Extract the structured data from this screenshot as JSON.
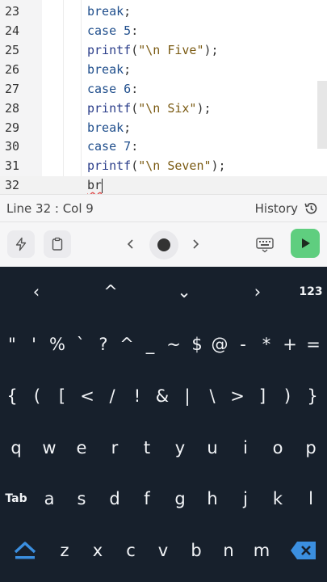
{
  "editor": {
    "lines": [
      {
        "num": "23",
        "tokens": [
          {
            "t": "break",
            "c": "kw"
          },
          {
            "t": ";",
            "c": "pl"
          }
        ]
      },
      {
        "num": "24",
        "tokens": [
          {
            "t": "case ",
            "c": "kw"
          },
          {
            "t": "5",
            "c": "kw"
          },
          {
            "t": ":",
            "c": "pl"
          }
        ]
      },
      {
        "num": "25",
        "tokens": [
          {
            "t": "printf",
            "c": "fn"
          },
          {
            "t": "(",
            "c": "pl"
          },
          {
            "t": "\"\\n Five\"",
            "c": "str"
          },
          {
            "t": ");",
            "c": "pl"
          }
        ]
      },
      {
        "num": "26",
        "tokens": [
          {
            "t": "break",
            "c": "kw"
          },
          {
            "t": ";",
            "c": "pl"
          }
        ]
      },
      {
        "num": "27",
        "tokens": [
          {
            "t": "case ",
            "c": "kw"
          },
          {
            "t": "6",
            "c": "kw"
          },
          {
            "t": ":",
            "c": "pl"
          }
        ]
      },
      {
        "num": "28",
        "tokens": [
          {
            "t": "printf",
            "c": "fn"
          },
          {
            "t": "(",
            "c": "pl"
          },
          {
            "t": "\"\\n Six\"",
            "c": "str"
          },
          {
            "t": ");",
            "c": "pl"
          }
        ]
      },
      {
        "num": "29",
        "tokens": [
          {
            "t": "break",
            "c": "kw"
          },
          {
            "t": ";",
            "c": "pl"
          }
        ]
      },
      {
        "num": "30",
        "tokens": [
          {
            "t": "case ",
            "c": "kw"
          },
          {
            "t": "7",
            "c": "kw"
          },
          {
            "t": ":",
            "c": "pl"
          }
        ]
      },
      {
        "num": "31",
        "tokens": [
          {
            "t": "printf",
            "c": "fn"
          },
          {
            "t": "(",
            "c": "pl"
          },
          {
            "t": "\"\\n Seven\"",
            "c": "str"
          },
          {
            "t": ");",
            "c": "pl"
          }
        ]
      },
      {
        "num": "32",
        "tokens": [
          {
            "t": "br",
            "c": "pl"
          }
        ]
      }
    ]
  },
  "status": {
    "position": "Line 32 : Col 9",
    "history_label": "History"
  },
  "toolbar": {
    "icons": [
      "lightning-icon",
      "clipboard-icon",
      "chevron-left-icon",
      "record-icon",
      "chevron-right-icon",
      "keyboard-icon",
      "play-icon"
    ],
    "run_color": "#5fce7f"
  },
  "keyboard": {
    "nav_row": [
      "‹",
      "^",
      "⌄",
      "›",
      "123"
    ],
    "row1": [
      "\"",
      "'",
      "%",
      "`",
      "?",
      "^",
      "_",
      "~",
      "$",
      "@",
      "-",
      "*",
      "+",
      "="
    ],
    "row2": [
      "{",
      "(",
      "[",
      "<",
      "/",
      "!",
      "&",
      "|",
      "\\",
      ">",
      "]",
      ")",
      "}"
    ],
    "row3": [
      "q",
      "w",
      "e",
      "r",
      "t",
      "y",
      "u",
      "i",
      "o",
      "p"
    ],
    "row4": [
      "Tab",
      "a",
      "s",
      "d",
      "f",
      "g",
      "h",
      "j",
      "k",
      "l"
    ],
    "row5": [
      "z",
      "x",
      "c",
      "v",
      "b",
      "n",
      "m"
    ],
    "accent_color": "#3b8fe0",
    "background": "#17202c"
  }
}
